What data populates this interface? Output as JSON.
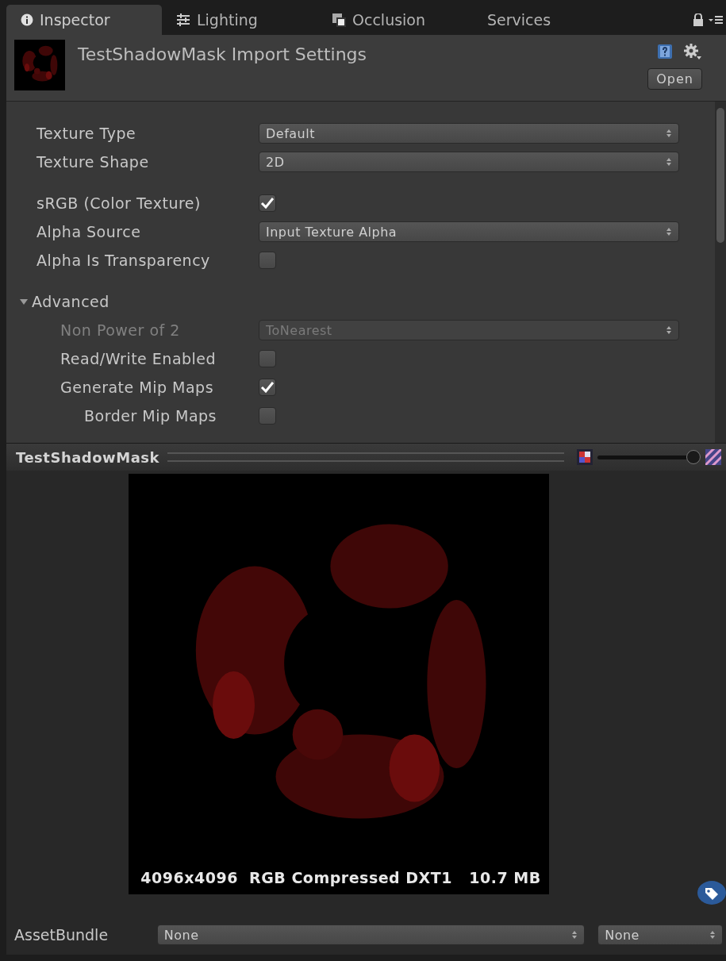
{
  "tabs": [
    {
      "label": "Inspector",
      "selected": true
    },
    {
      "label": "Lighting",
      "selected": false
    },
    {
      "label": "Occlusion",
      "selected": false
    },
    {
      "label": "Services",
      "selected": false
    }
  ],
  "header": {
    "title": "TestShadowMask Import Settings",
    "open_button": "Open"
  },
  "settings": [
    {
      "kind": "dropdown",
      "label": "Texture Type",
      "value": "Default",
      "disabled": false
    },
    {
      "kind": "dropdown",
      "label": "Texture Shape",
      "value": "2D",
      "disabled": false
    },
    {
      "kind": "spacer"
    },
    {
      "kind": "checkbox",
      "label": "sRGB (Color Texture)",
      "checked": true,
      "disabled": false
    },
    {
      "kind": "dropdown",
      "label": "Alpha Source",
      "value": "Input Texture Alpha",
      "disabled": false
    },
    {
      "kind": "checkbox",
      "label": "Alpha Is Transparency",
      "checked": false,
      "disabled": false
    },
    {
      "kind": "spacer"
    },
    {
      "kind": "foldout",
      "label": "Advanced",
      "expanded": true,
      "children": [
        {
          "kind": "dropdown",
          "label": "Non Power of 2",
          "value": "ToNearest",
          "disabled": true
        },
        {
          "kind": "checkbox",
          "label": "Read/Write Enabled",
          "checked": false,
          "disabled": false
        },
        {
          "kind": "checkbox",
          "label": "Generate Mip Maps",
          "checked": true,
          "disabled": false,
          "children": [
            {
              "kind": "checkbox",
              "label": "Border Mip Maps",
              "checked": false,
              "disabled": false
            }
          ]
        }
      ]
    }
  ],
  "preview": {
    "title": "TestShadowMask",
    "zoom": {
      "level": 1.0
    },
    "info": "4096x4096  RGB Compressed DXT1   10.7 MB"
  },
  "asset_bundle": {
    "label": "AssetBundle",
    "name": "None",
    "variant": "None"
  }
}
